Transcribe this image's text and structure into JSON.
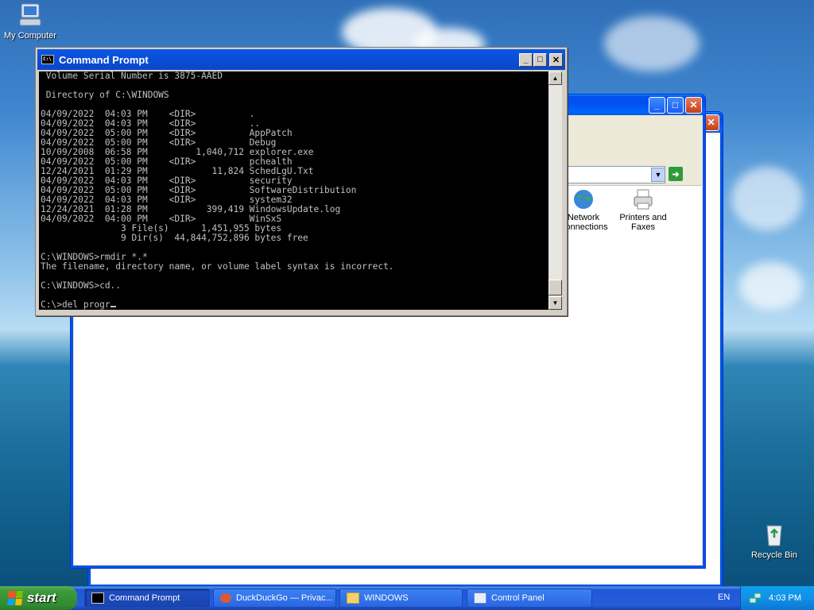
{
  "desktop": {
    "icons": [
      {
        "label": "My Computer"
      },
      {
        "label": "Recycle Bin"
      }
    ]
  },
  "cmd": {
    "title": "Command Prompt",
    "lines": [
      " Volume Serial Number is 3875-AAED",
      "",
      " Directory of C:\\WINDOWS",
      "",
      "04/09/2022  04:03 PM    <DIR>          .",
      "04/09/2022  04:03 PM    <DIR>          ..",
      "04/09/2022  05:00 PM    <DIR>          AppPatch",
      "04/09/2022  05:00 PM    <DIR>          Debug",
      "10/09/2008  06:58 PM         1,040,712 explorer.exe",
      "04/09/2022  05:00 PM    <DIR>          pchealth",
      "12/24/2021  01:29 PM            11,824 SchedLgU.Txt",
      "04/09/2022  04:03 PM    <DIR>          security",
      "04/09/2022  05:00 PM    <DIR>          SoftwareDistribution",
      "04/09/2022  04:03 PM    <DIR>          system32",
      "12/24/2021  01:28 PM           399,419 WindowsUpdate.log",
      "04/09/2022  04:00 PM    <DIR>          WinSxS",
      "               3 File(s)      1,451,955 bytes",
      "               9 Dir(s)  44,844,752,896 bytes free",
      "",
      "C:\\WINDOWS>rmdir *.*",
      "The filename, directory name, or volume label syntax is incorrect.",
      "",
      "C:\\WINDOWS>cd..",
      ""
    ],
    "prompt": "C:\\>del progr",
    "icon_text": "C:\\"
  },
  "explorer": {
    "items": [
      {
        "label_line1": "Network",
        "label_line2": "Connections"
      },
      {
        "label_line1": "Printers and",
        "label_line2": "Faxes"
      }
    ]
  },
  "taskbar": {
    "start_label": "start",
    "tasks": [
      {
        "label": "Command Prompt",
        "icon": "cmd-icon",
        "active": true
      },
      {
        "label": "DuckDuckGo — Privac...",
        "icon": "browser-icon",
        "active": false
      },
      {
        "label": "WINDOWS",
        "icon": "folder-icon",
        "active": false
      },
      {
        "label": "Control Panel",
        "icon": "control-panel-icon",
        "active": false
      }
    ],
    "language": "EN",
    "clock": "4:03 PM"
  },
  "colors": {
    "console_bg": "#000000",
    "console_fg": "#c0c0c0",
    "xp_title_blue": "#0058ee",
    "start_green": "#3c9c3c"
  }
}
